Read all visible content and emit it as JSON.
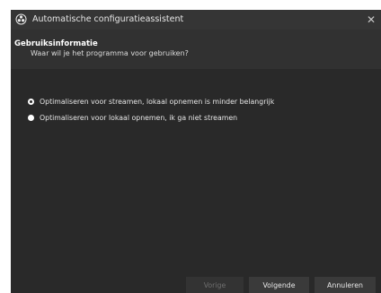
{
  "window": {
    "title": "Automatische configuratieassistent",
    "close_glyph": "✕"
  },
  "header": {
    "title": "Gebruiksinformatie",
    "subtitle": "Waar wil je het programma voor gebruiken?"
  },
  "options": [
    {
      "label": "Optimaliseren voor streamen, lokaal opnemen is minder belangrijk",
      "selected": true
    },
    {
      "label": "Optimaliseren voor lokaal opnemen, ik ga niet streamen",
      "selected": false
    }
  ],
  "buttons": {
    "back": "Vorige",
    "next": "Volgende",
    "cancel": "Annuleren"
  },
  "colors": {
    "background": "#292929",
    "titlebar": "#353535",
    "button": "#3a3a3a"
  },
  "icons": {
    "app": "obs-logo-icon",
    "close": "close-icon"
  }
}
